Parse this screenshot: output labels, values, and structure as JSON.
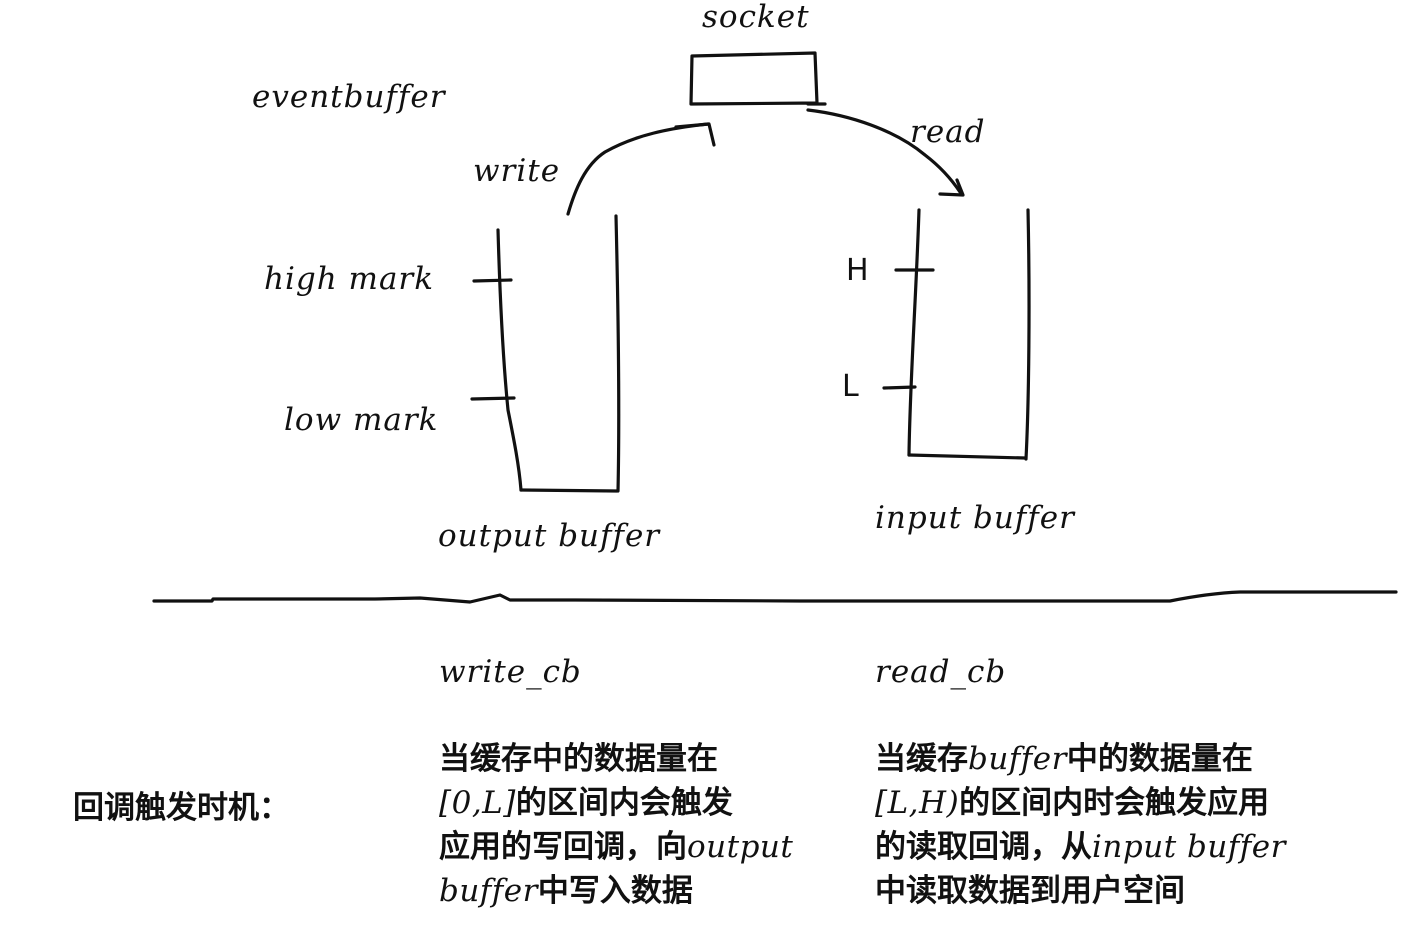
{
  "labels": {
    "socket": "socket",
    "eventbuffer": "eventbuffer",
    "write": "write",
    "read": "read",
    "high_mark": "high mark",
    "low_mark": "low mark",
    "h": "H",
    "l": "L",
    "output_buffer": "output buffer",
    "input_buffer": "input buffer",
    "write_cb": "write_cb",
    "read_cb": "read_cb"
  },
  "callback_timing_label": "回调触发时机：",
  "write_cb_description": {
    "line1": "当缓存中的数据量在",
    "line2_range": "[0,L]",
    "line2_rest": "的区间内会触发",
    "line3_cn": "应用的写回调，向",
    "line3_latin": "output",
    "line4_latin": "buffer",
    "line4_cn": "中写入数据"
  },
  "read_cb_description": {
    "line1_cn_a": "当缓存",
    "line1_latin": "buffer",
    "line1_cn_b": "中的数据量在",
    "line2_range": "[L,H)",
    "line2_rest": "的区间内时会触发应用",
    "line3_cn": "的读取回调，从",
    "line3_latin": "input buffer",
    "line4_cn": "中读取数据到用户空间"
  }
}
